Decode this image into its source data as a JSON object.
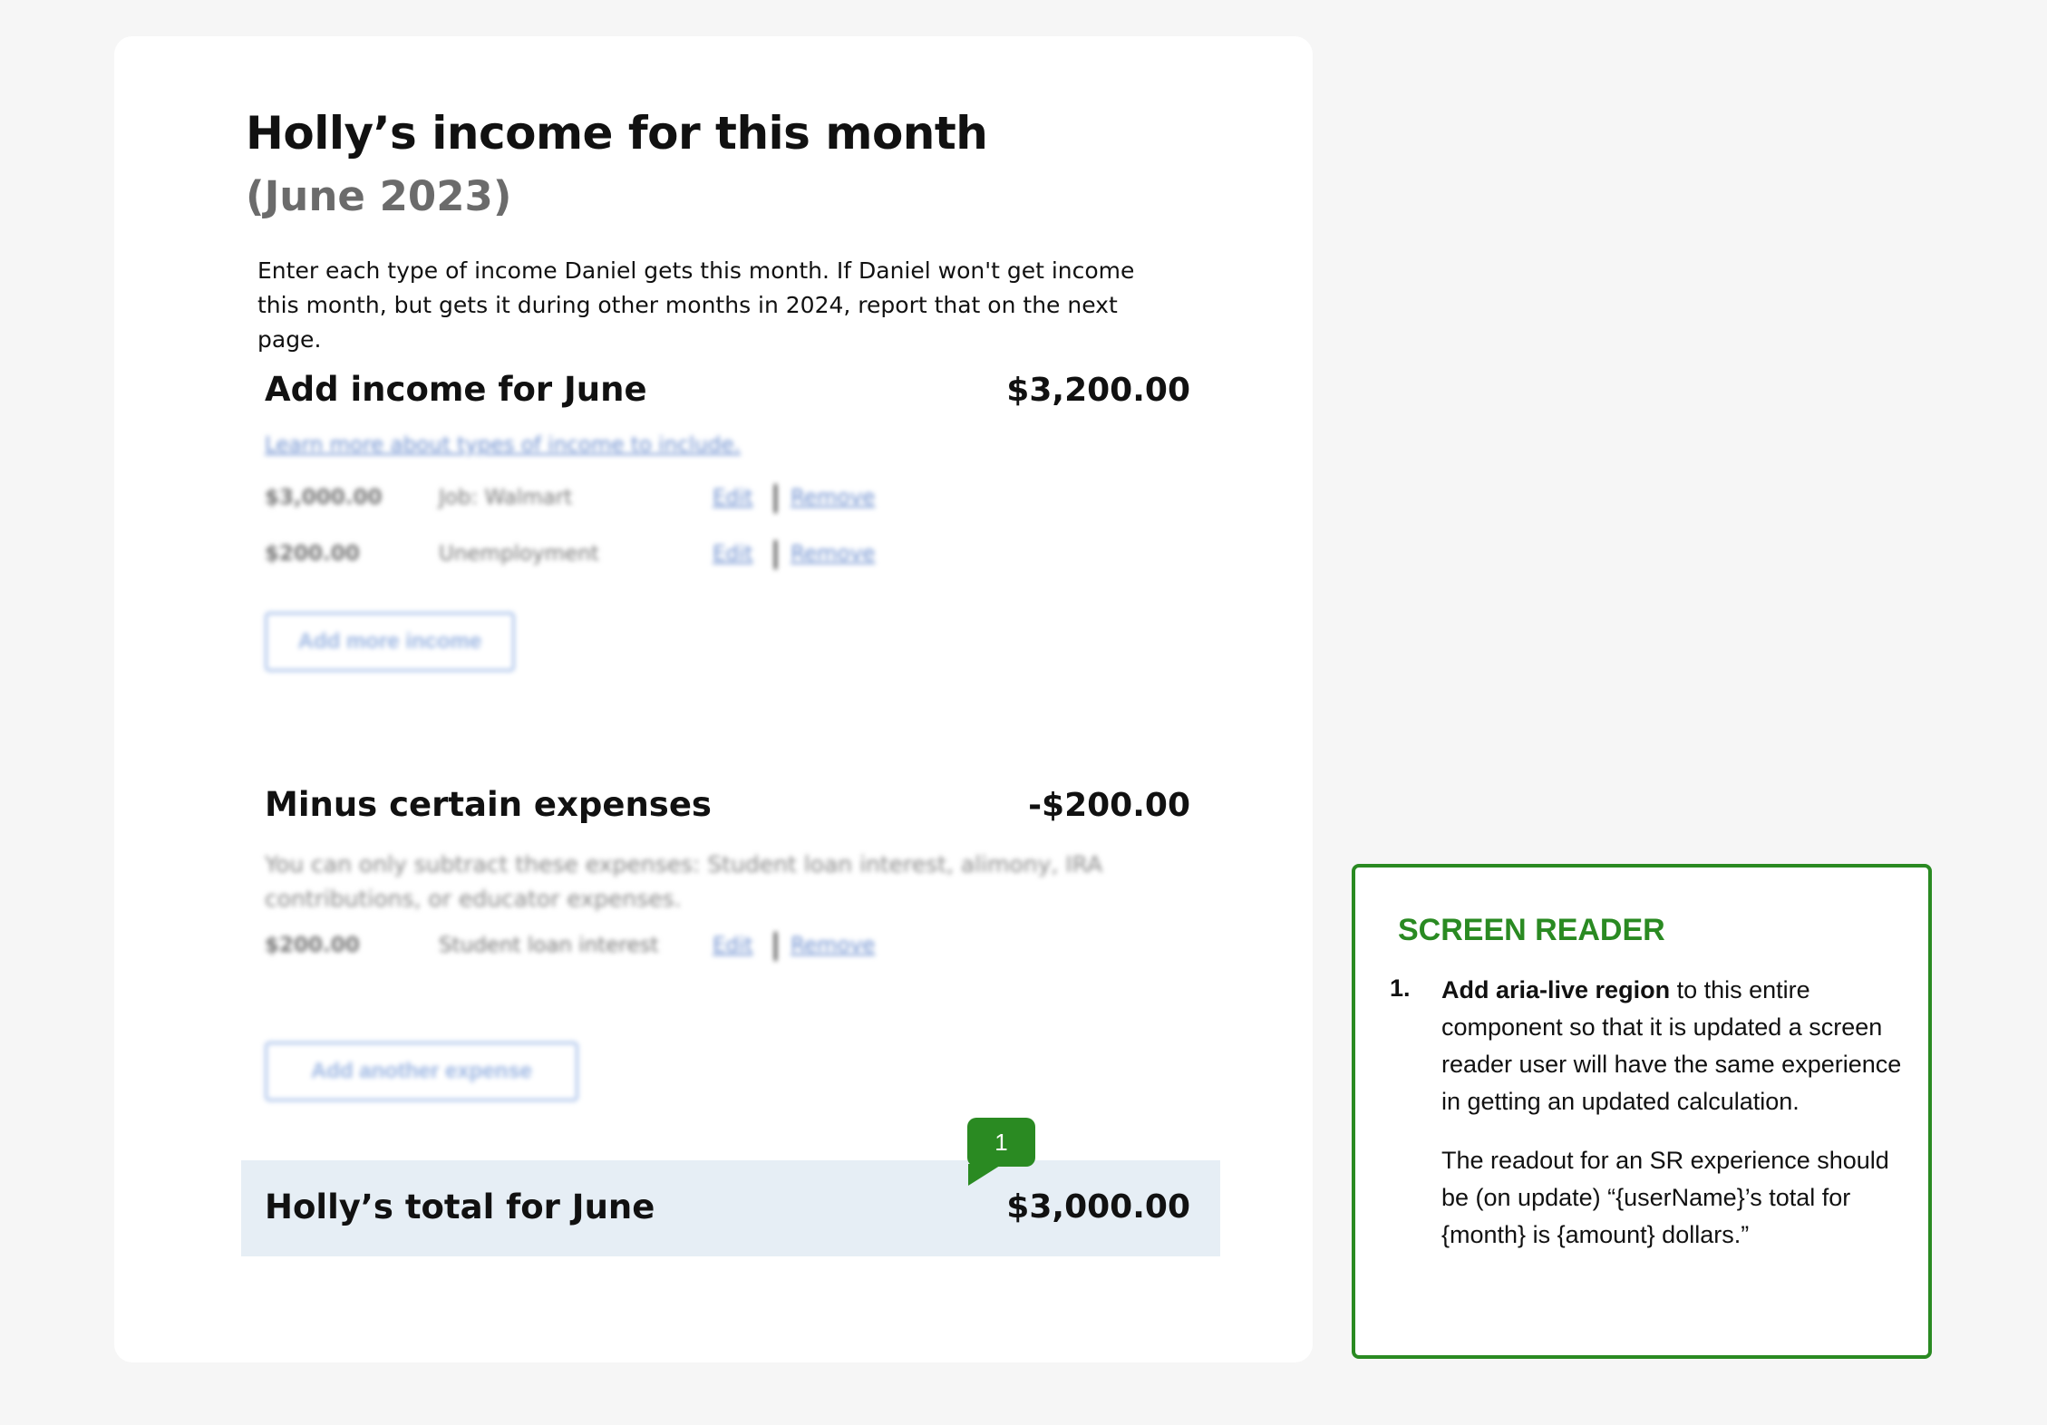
{
  "page": {
    "title": "Holly’s income for this month",
    "subtitle": "(June 2023)",
    "intro": "Enter each type of income Daniel gets this month. If Daniel won't get income this month, but gets it during other months in 2024, report that on the next page."
  },
  "income": {
    "heading": "Add income for June",
    "amount": "$3,200.00",
    "learn_link": "Learn more about types of income to include.",
    "rows": [
      {
        "amount": "$3,000.00",
        "source": "Job: Walmart",
        "edit": "Edit",
        "remove": "Remove"
      },
      {
        "amount": "$200.00",
        "source": "Unemployment",
        "edit": "Edit",
        "remove": "Remove"
      }
    ],
    "add_button": "Add more income"
  },
  "expenses": {
    "heading": "Minus certain expenses",
    "amount": "-$200.00",
    "note": "You can only subtract these expenses: Student loan interest, alimony, IRA contributions, or educator expenses.",
    "rows": [
      {
        "amount": "$200.00",
        "source": "Student loan interest",
        "edit": "Edit",
        "remove": "Remove"
      }
    ],
    "add_button": "Add another expense"
  },
  "total": {
    "label": "Holly’s total for June",
    "amount": "$3,000.00"
  },
  "annotation": {
    "marker": "1",
    "heading": "SCREEN READER",
    "item_number": "1.",
    "item_bold": "Add aria-live region",
    "item_text": " to this entire component so that it is updated a screen reader user will have the same experience in getting an updated calculation.",
    "item_text2": "The readout for an SR experience should be (on update) “{userName}’s total for {month} is {amount} dollars.”"
  },
  "colors": {
    "accent_green": "#2a8a22",
    "total_bg": "#e6eef5",
    "link_blue": "#6d8fcf"
  }
}
